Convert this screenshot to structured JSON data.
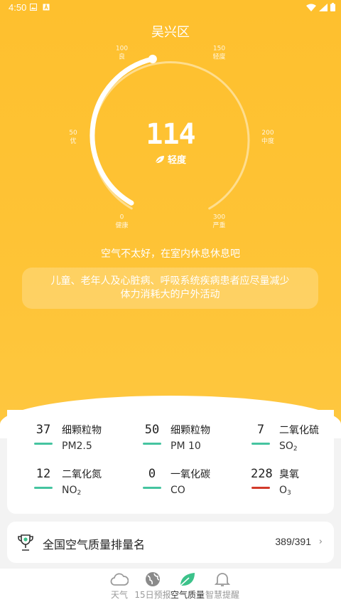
{
  "status_bar": {
    "time": "4:50"
  },
  "location": {
    "name": "吴兴区"
  },
  "gauge": {
    "value": "114",
    "level": "轻度",
    "scale_min": 0,
    "scale_max": 300,
    "current": 114,
    "ticks": [
      {
        "value": "0",
        "label": "健康"
      },
      {
        "value": "50",
        "label": "优"
      },
      {
        "value": "100",
        "label": "良"
      },
      {
        "value": "150",
        "label": "轻度"
      },
      {
        "value": "200",
        "label": "中度"
      },
      {
        "value": "300",
        "label": "严重"
      }
    ]
  },
  "advice": "空气不太好，在室内休息休息吧",
  "health_tip": {
    "line1": "儿童、老年人及心脏病、呼吸系统疾病患者应尽量减少",
    "line2": "体力消耗大的户外活动"
  },
  "pollutants": [
    {
      "value": "37",
      "name": "细颗粒物",
      "code": "PM2.5",
      "sub": "",
      "bar_color": "#45c4a0"
    },
    {
      "value": "50",
      "name": "细颗粒物",
      "code": "PM 10",
      "sub": "",
      "bar_color": "#45c4a0"
    },
    {
      "value": "7",
      "name": "二氧化硫",
      "code": "SO",
      "sub": "2",
      "bar_color": "#45c4a0"
    },
    {
      "value": "12",
      "name": "二氧化氮",
      "code": "NO",
      "sub": "2",
      "bar_color": "#45c4a0"
    },
    {
      "value": "0",
      "name": "一氧化碳",
      "code": "CO",
      "sub": "",
      "bar_color": "#45c4a0"
    },
    {
      "value": "228",
      "name": "臭氧",
      "code": "O",
      "sub": "3",
      "bar_color": "#d23a2a"
    }
  ],
  "ranking": {
    "label": "全国空气质量排量名",
    "value": "389/391"
  },
  "nav": [
    {
      "label": "天气",
      "icon": "cloud-icon"
    },
    {
      "label": "15日预报",
      "icon": "globe-icon"
    },
    {
      "label": "空气质量",
      "icon": "leaf-icon"
    },
    {
      "label": "智慧提醒",
      "icon": "bell-icon"
    }
  ],
  "colors": {
    "hero": "#fec02e",
    "good": "#45c4a0",
    "bad": "#d23a2a",
    "leaf": "#3cc28a"
  }
}
